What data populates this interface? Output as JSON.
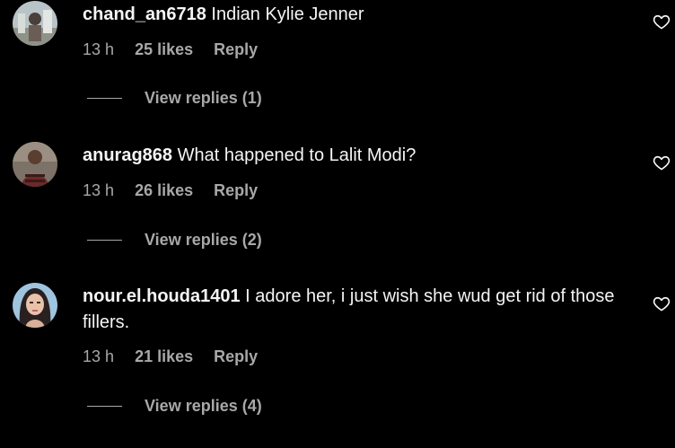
{
  "comments": [
    {
      "username": "chand_an6718",
      "text": "Indian Kylie Jenner",
      "time": "13 h",
      "likes": "25 likes",
      "reply_label": "Reply",
      "view_replies": "View replies (1)"
    },
    {
      "username": "anurag868",
      "text": "What happened to Lalit Modi?",
      "time": "13 h",
      "likes": "26 likes",
      "reply_label": "Reply",
      "view_replies": "View replies (2)"
    },
    {
      "username": "nour.el.houda1401",
      "text": "I adore her, i just wish she wud get rid of those fillers.",
      "time": "13 h",
      "likes": "21 likes",
      "reply_label": "Reply",
      "view_replies": "View replies (4)"
    }
  ],
  "colors": {
    "background": "#000000",
    "primary_text": "#f5f5f5",
    "secondary_text": "#a8a8a8"
  },
  "icons": {
    "like": "heart-outline-icon"
  }
}
